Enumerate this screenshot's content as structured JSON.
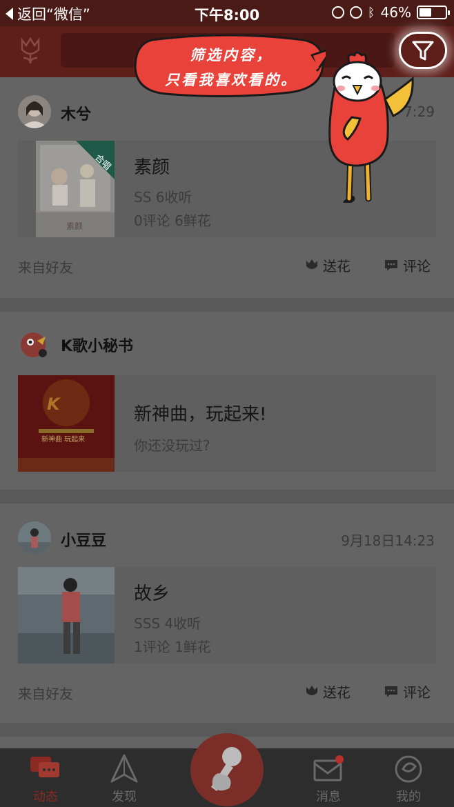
{
  "status_bar": {
    "back_label": "返回“微信”",
    "time": "下午8:00",
    "battery_text": "46%",
    "battery_level": 0.46
  },
  "nav": {
    "logo_icon": "tulip-logo-icon",
    "filter_icon": "funnel-filter-icon"
  },
  "tooltip": {
    "line1": "筛选内容，",
    "line2": "只看我喜欢看的。"
  },
  "feed": [
    {
      "username": "木兮",
      "timestamp": "7:29",
      "badge": "合唱",
      "cover_caption": "素颜",
      "song_title": "素颜",
      "meta1": "SS  6收听",
      "meta2": "0评论  6鲜花",
      "from": "来自好友",
      "flower_label": "送花",
      "comment_label": "评论"
    },
    {
      "username": "K歌小秘书",
      "song_title": "新神曲，玩起来!",
      "meta1": "你还没玩过?",
      "cover_line1": "新神曲  玩起来"
    },
    {
      "username": "小豆豆",
      "timestamp": "9月18日14:23",
      "song_title": "故乡",
      "meta1": "SSS  4收听",
      "meta2": "1评论  1鲜花",
      "from": "来自好友",
      "flower_label": "送花",
      "comment_label": "评论"
    }
  ],
  "tabs": [
    {
      "label": "动态",
      "icon": "chat-bubbles-icon"
    },
    {
      "label": "发现",
      "icon": "compass-icon"
    },
    {
      "label": "消息",
      "icon": "envelope-icon"
    },
    {
      "label": "我的",
      "icon": "profile-icon"
    }
  ],
  "colors": {
    "brand": "#e8423a",
    "active_tab": "#8a2a22"
  }
}
